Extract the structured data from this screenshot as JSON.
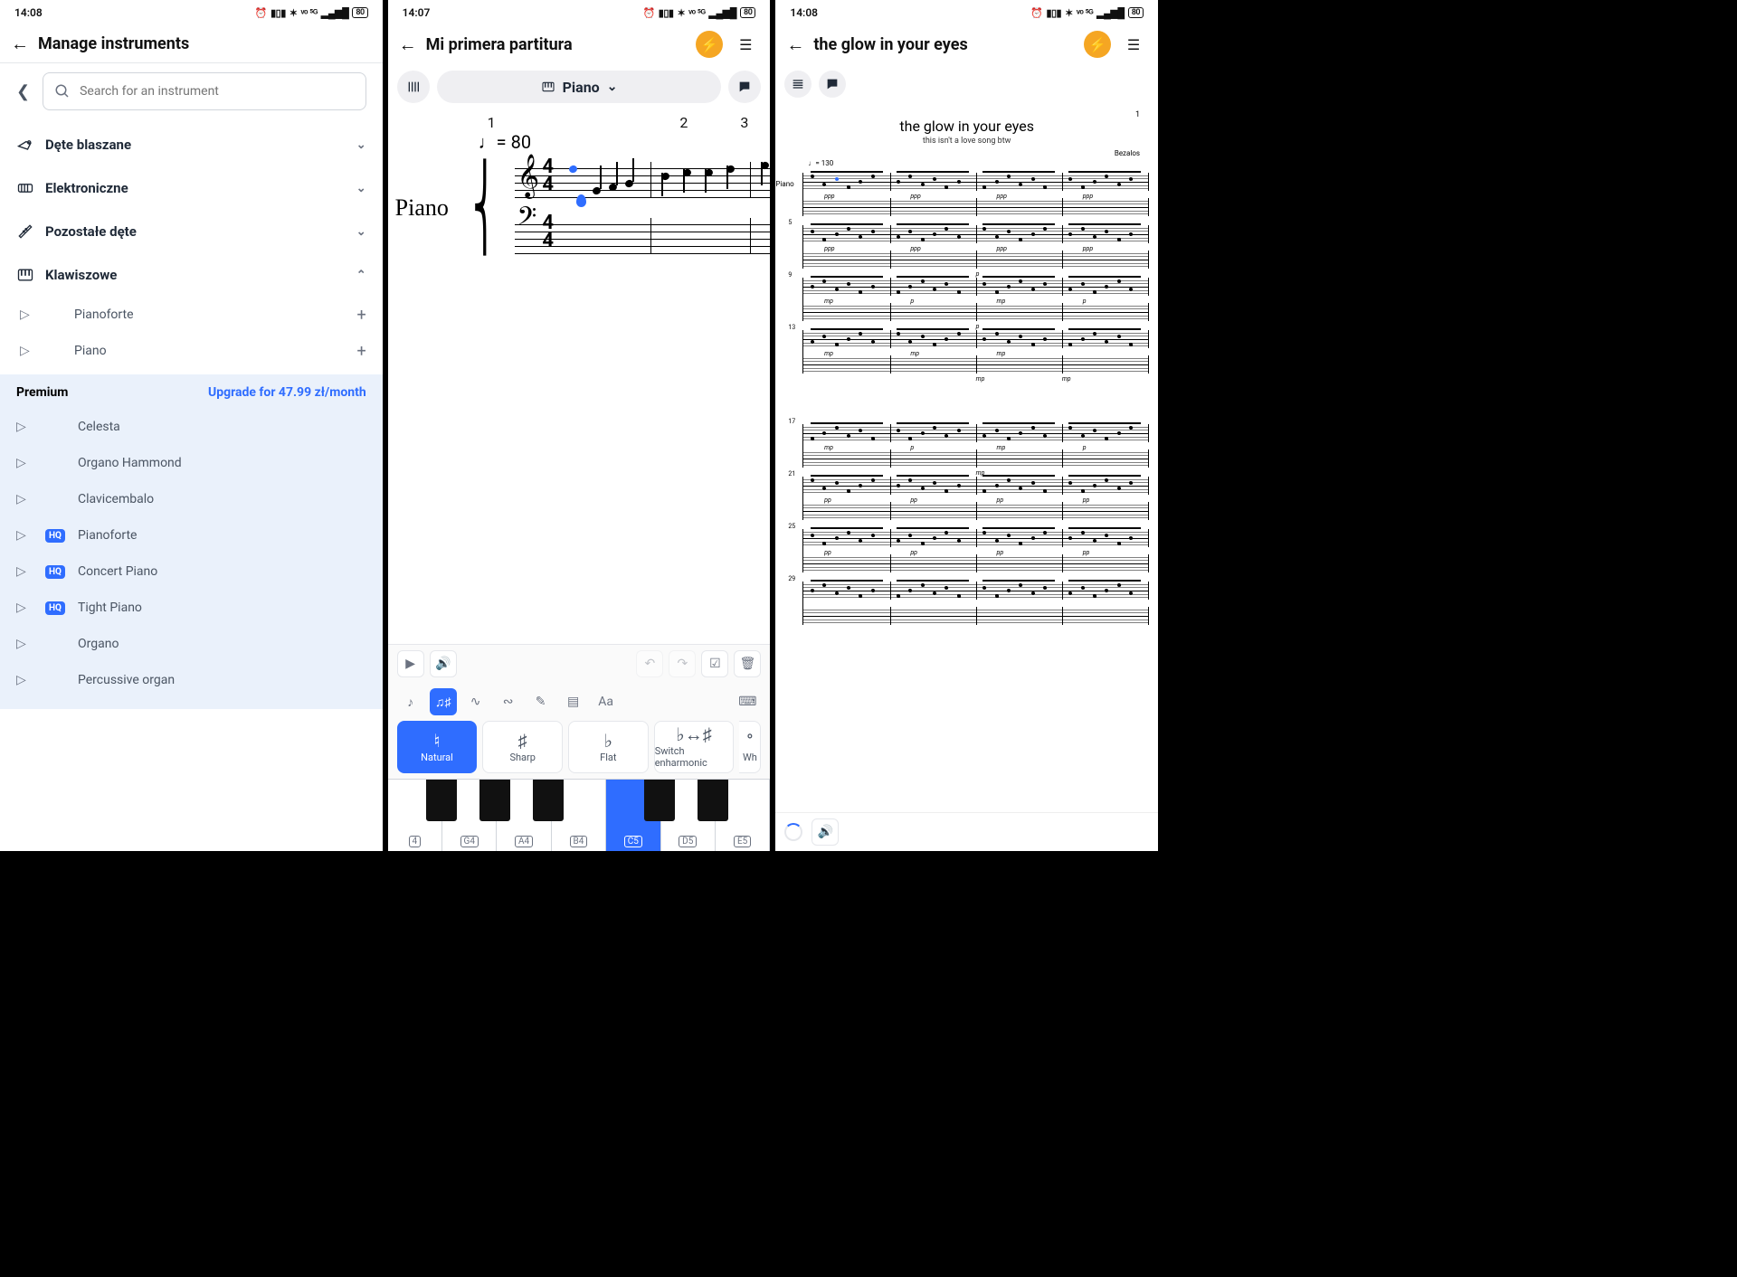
{
  "status": {
    "time1": "14:08",
    "time2": "14:07",
    "time3": "14:08",
    "battery": "80"
  },
  "s1": {
    "title": "Manage instruments",
    "search_placeholder": "Search for an instrument",
    "groups": [
      {
        "name": "Dęte blaszane",
        "expanded": false
      },
      {
        "name": "Elektroniczne",
        "expanded": false
      },
      {
        "name": "Pozostałe dęte",
        "expanded": false
      },
      {
        "name": "Klawiszowe",
        "expanded": true
      }
    ],
    "free_items": [
      {
        "name": "Pianoforte"
      },
      {
        "name": "Piano"
      }
    ],
    "premium_label": "Premium",
    "upgrade_text": "Upgrade for 47.99 zł/month",
    "premium_items": [
      {
        "name": "Celesta",
        "hq": false
      },
      {
        "name": "Organo Hammond",
        "hq": false
      },
      {
        "name": "Clavicembalo",
        "hq": false
      },
      {
        "name": "Pianoforte",
        "hq": true
      },
      {
        "name": "Concert Piano",
        "hq": true
      },
      {
        "name": "Tight Piano",
        "hq": true
      },
      {
        "name": "Organo",
        "hq": false
      },
      {
        "name": "Percussive organ",
        "hq": false
      }
    ],
    "hq_badge": "HQ"
  },
  "s2": {
    "title": "Mi primera partitura",
    "instrument_pill": "Piano",
    "measures": [
      "1",
      "2",
      "3"
    ],
    "tempo": "= 80",
    "instrument_label": "Piano",
    "timesig_top": "4",
    "timesig_bot": "4",
    "accidentals": [
      {
        "sym": "♮",
        "label": "Natural",
        "selected": true
      },
      {
        "sym": "♯",
        "label": "Sharp",
        "selected": false
      },
      {
        "sym": "♭",
        "label": "Flat",
        "selected": false
      },
      {
        "sym": "♭↔♯",
        "label": "Switch enharmonic",
        "selected": false
      },
      {
        "sym": "°",
        "label": "Wh",
        "selected": false
      }
    ],
    "keys": [
      "4",
      "G4",
      "A4",
      "B4",
      "C5",
      "D5",
      "E5"
    ],
    "selected_key": "C5"
  },
  "s3": {
    "title": "the glow in your eyes",
    "page": "1",
    "sheet_title": "the glow in your eyes",
    "sheet_subtitle": "this isn't a love song btw",
    "author": "Bezalos",
    "tempo": "♩= 130",
    "part_label": "Piano",
    "systems": [
      {
        "m": "",
        "dyn": [
          "ppp",
          "ppp",
          "ppp",
          "ppp"
        ]
      },
      {
        "m": "5",
        "dyn": [
          "ppp",
          "ppp",
          "ppp",
          "ppp"
        ],
        "low": [
          "p"
        ]
      },
      {
        "m": "9",
        "dyn": [
          "mp",
          "p",
          "mp",
          "p"
        ],
        "low": [
          "p"
        ]
      },
      {
        "m": "13",
        "dyn": [
          "mp",
          "mp",
          "mp"
        ],
        "low": [
          "mp",
          "mp"
        ]
      },
      {
        "m": "17",
        "dyn": [
          "mp",
          "p",
          "mp",
          "p"
        ],
        "low": [
          "mp"
        ]
      },
      {
        "m": "21",
        "dyn": [
          "pp",
          "pp",
          "pp",
          "pp"
        ]
      },
      {
        "m": "25",
        "dyn": [
          "pp",
          "pp",
          "pp",
          "pp"
        ]
      },
      {
        "m": "29",
        "dyn": []
      }
    ]
  }
}
